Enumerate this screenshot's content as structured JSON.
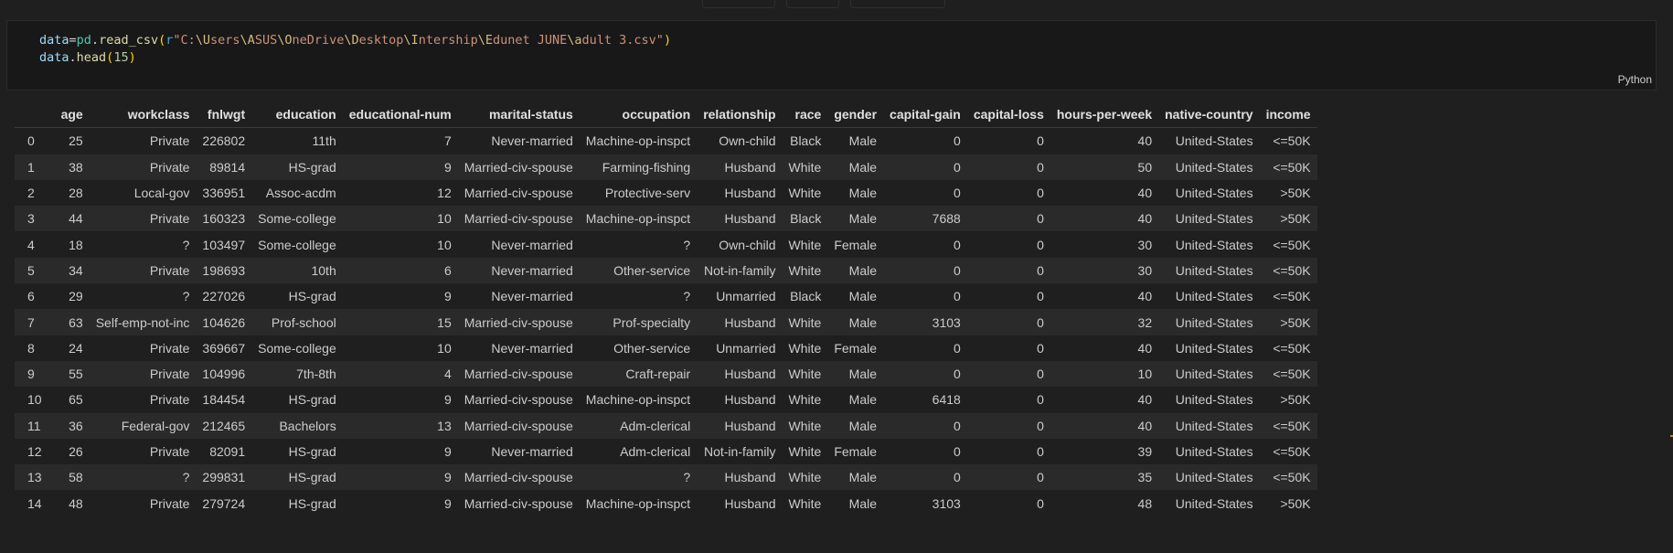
{
  "code_cell": {
    "line1": {
      "var": "data",
      "eq": "=",
      "module": "pd",
      "dot": ".",
      "func": "read_csv",
      "open_paren": "(",
      "prefix": "r",
      "path_parts": [
        {
          "t": "str",
          "v": "\"C:"
        },
        {
          "t": "esc",
          "v": "\\U"
        },
        {
          "t": "str",
          "v": "sers"
        },
        {
          "t": "esc",
          "v": "\\A"
        },
        {
          "t": "str",
          "v": "SUS"
        },
        {
          "t": "esc",
          "v": "\\O"
        },
        {
          "t": "str",
          "v": "neDrive"
        },
        {
          "t": "esc",
          "v": "\\D"
        },
        {
          "t": "str",
          "v": "esktop"
        },
        {
          "t": "esc",
          "v": "\\I"
        },
        {
          "t": "str",
          "v": "ntership"
        },
        {
          "t": "esc",
          "v": "\\E"
        },
        {
          "t": "str",
          "v": "dunet JUNE"
        },
        {
          "t": "esc",
          "v": "\\a"
        },
        {
          "t": "str",
          "v": "dult 3.csv\""
        }
      ],
      "close_paren": ")"
    },
    "line2": {
      "var": "data",
      "dot": ".",
      "func": "head",
      "open_paren": "(",
      "arg": "15",
      "close_paren": ")"
    },
    "language": "Python"
  },
  "table": {
    "columns": [
      "",
      "age",
      "workclass",
      "fnlwgt",
      "education",
      "educational-num",
      "marital-status",
      "occupation",
      "relationship",
      "race",
      "gender",
      "capital-gain",
      "capital-loss",
      "hours-per-week",
      "native-country",
      "income"
    ],
    "rows": [
      [
        "0",
        "25",
        "Private",
        "226802",
        "11th",
        "7",
        "Never-married",
        "Machine-op-inspct",
        "Own-child",
        "Black",
        "Male",
        "0",
        "0",
        "40",
        "United-States",
        "<=50K"
      ],
      [
        "1",
        "38",
        "Private",
        "89814",
        "HS-grad",
        "9",
        "Married-civ-spouse",
        "Farming-fishing",
        "Husband",
        "White",
        "Male",
        "0",
        "0",
        "50",
        "United-States",
        "<=50K"
      ],
      [
        "2",
        "28",
        "Local-gov",
        "336951",
        "Assoc-acdm",
        "12",
        "Married-civ-spouse",
        "Protective-serv",
        "Husband",
        "White",
        "Male",
        "0",
        "0",
        "40",
        "United-States",
        ">50K"
      ],
      [
        "3",
        "44",
        "Private",
        "160323",
        "Some-college",
        "10",
        "Married-civ-spouse",
        "Machine-op-inspct",
        "Husband",
        "Black",
        "Male",
        "7688",
        "0",
        "40",
        "United-States",
        ">50K"
      ],
      [
        "4",
        "18",
        "?",
        "103497",
        "Some-college",
        "10",
        "Never-married",
        "?",
        "Own-child",
        "White",
        "Female",
        "0",
        "0",
        "30",
        "United-States",
        "<=50K"
      ],
      [
        "5",
        "34",
        "Private",
        "198693",
        "10th",
        "6",
        "Never-married",
        "Other-service",
        "Not-in-family",
        "White",
        "Male",
        "0",
        "0",
        "30",
        "United-States",
        "<=50K"
      ],
      [
        "6",
        "29",
        "?",
        "227026",
        "HS-grad",
        "9",
        "Never-married",
        "?",
        "Unmarried",
        "Black",
        "Male",
        "0",
        "0",
        "40",
        "United-States",
        "<=50K"
      ],
      [
        "7",
        "63",
        "Self-emp-not-inc",
        "104626",
        "Prof-school",
        "15",
        "Married-civ-spouse",
        "Prof-specialty",
        "Husband",
        "White",
        "Male",
        "3103",
        "0",
        "32",
        "United-States",
        ">50K"
      ],
      [
        "8",
        "24",
        "Private",
        "369667",
        "Some-college",
        "10",
        "Never-married",
        "Other-service",
        "Unmarried",
        "White",
        "Female",
        "0",
        "0",
        "40",
        "United-States",
        "<=50K"
      ],
      [
        "9",
        "55",
        "Private",
        "104996",
        "7th-8th",
        "4",
        "Married-civ-spouse",
        "Craft-repair",
        "Husband",
        "White",
        "Male",
        "0",
        "0",
        "10",
        "United-States",
        "<=50K"
      ],
      [
        "10",
        "65",
        "Private",
        "184454",
        "HS-grad",
        "9",
        "Married-civ-spouse",
        "Machine-op-inspct",
        "Husband",
        "White",
        "Male",
        "6418",
        "0",
        "40",
        "United-States",
        ">50K"
      ],
      [
        "11",
        "36",
        "Federal-gov",
        "212465",
        "Bachelors",
        "13",
        "Married-civ-spouse",
        "Adm-clerical",
        "Husband",
        "White",
        "Male",
        "0",
        "0",
        "40",
        "United-States",
        "<=50K"
      ],
      [
        "12",
        "26",
        "Private",
        "82091",
        "HS-grad",
        "9",
        "Never-married",
        "Adm-clerical",
        "Not-in-family",
        "White",
        "Female",
        "0",
        "0",
        "39",
        "United-States",
        "<=50K"
      ],
      [
        "13",
        "58",
        "?",
        "299831",
        "HS-grad",
        "9",
        "Married-civ-spouse",
        "?",
        "Husband",
        "White",
        "Male",
        "0",
        "0",
        "35",
        "United-States",
        "<=50K"
      ],
      [
        "14",
        "48",
        "Private",
        "279724",
        "HS-grad",
        "9",
        "Married-civ-spouse",
        "Machine-op-inspct",
        "Husband",
        "White",
        "Male",
        "3103",
        "0",
        "48",
        "United-States",
        ">50K"
      ]
    ]
  },
  "colors": {
    "background": "#1f1f1f",
    "cell_background": "#181818",
    "stripe": "#2a2a2a",
    "text": "#cccccc"
  }
}
